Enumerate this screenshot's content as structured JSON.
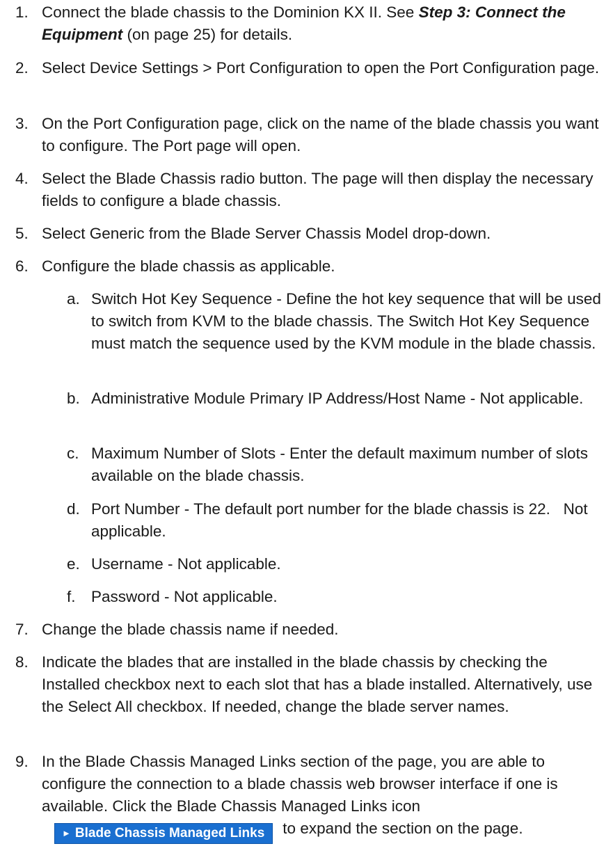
{
  "steps": [
    {
      "num": "1.",
      "text_a": "Connect the blade chassis to the Dominion KX II. See ",
      "ref": "Step 3: Connect the Equipment",
      "text_b": " (on page 25) for details."
    },
    {
      "num": "2.",
      "text": "Select Device Settings > Port Configuration to open the Port Configuration page."
    },
    {
      "num": "3.",
      "text": "On the Port Configuration page, click on the name of the blade chassis you want to configure. The Port page will open."
    },
    {
      "num": "4.",
      "text": "Select the Blade Chassis radio button. The page will then display the necessary fields to configure a blade chassis."
    },
    {
      "num": "5.",
      "text": "Select Generic from the Blade Server Chassis Model drop-down."
    },
    {
      "num": "6.",
      "text": "Configure the blade chassis as applicable."
    },
    {
      "num": "7.",
      "text": "Change the blade chassis name if needed."
    },
    {
      "num": "8.",
      "text": "Indicate the blades that are installed in the blade chassis by checking the Installed checkbox next to each slot that has a blade installed. Alternatively, use the Select All checkbox. If needed, change the blade server names."
    },
    {
      "num": "9.",
      "text_a": "In the Blade Chassis Managed Links section of the page, you are able to configure the connection to a blade chassis web browser interface if one is available. Click the Blade Chassis Managed Links icon",
      "text_b": "to expand the section on the page."
    }
  ],
  "substeps": [
    {
      "num": "a.",
      "text": "Switch Hot Key Sequence - Define the hot key sequence that will be used to switch from KVM to the blade chassis. The Switch Hot Key Sequence must match the sequence used by the KVM module in the blade chassis."
    },
    {
      "num": "b.",
      "text": "Administrative Module Primary IP Address/Host Name - Not applicable."
    },
    {
      "num": "c.",
      "text": "Maximum Number of Slots - Enter the default maximum number of slots available on the blade chassis."
    },
    {
      "num": "d.",
      "text": "Port Number - The default port number for the blade chassis is 22.   Not applicable."
    },
    {
      "num": "e.",
      "text": "Username - Not applicable."
    },
    {
      "num": "f.",
      "text": "Password - Not applicable."
    }
  ],
  "managed_links_button": {
    "label": "Blade Chassis Managed Links",
    "icon": "triangle-right-icon",
    "bg_color": "#1a6fd0"
  }
}
